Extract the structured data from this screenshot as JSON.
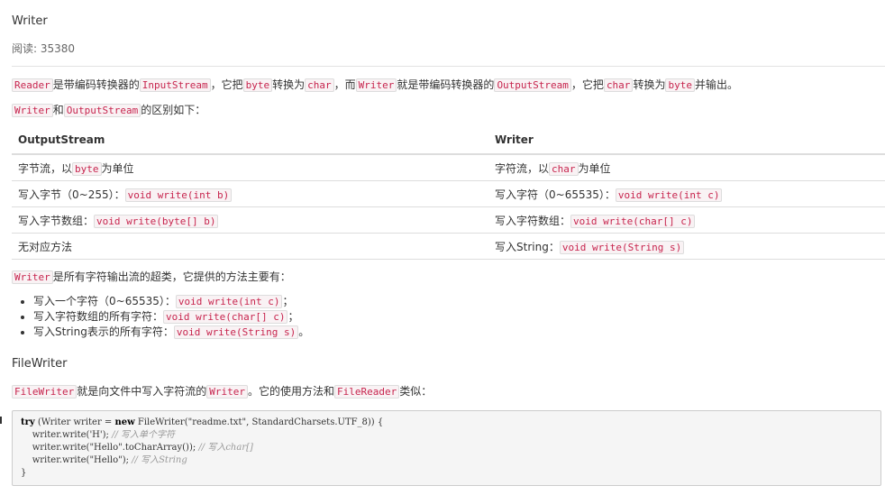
{
  "article": {
    "title": "Writer",
    "views_label": "阅读:",
    "views": "35380"
  },
  "intro": {
    "s1": "Reader",
    "s2": "是带编码转换器的",
    "s3": "InputStream",
    "s4": "，它把",
    "s5": "byte",
    "s6": "转换为",
    "s7": "char",
    "s8": "，而",
    "s9": "Writer",
    "s10": "就是带编码转换器的",
    "s11": "OutputStream",
    "s12": "，它把",
    "s13": "char",
    "s14": "转换为",
    "s15": "byte",
    "s16": "并输出。"
  },
  "diff": {
    "a": "Writer",
    "b": "和",
    "c": "OutputStream",
    "d": "的区别如下："
  },
  "table": {
    "h1": "OutputStream",
    "h2": "Writer",
    "r1": {
      "l_pre": "字节流，以",
      "l_code": "byte",
      "l_post": "为单位",
      "r_pre": "字符流，以",
      "r_code": "char",
      "r_post": "为单位"
    },
    "r2": {
      "l_pre": "写入字节（0~255）：",
      "l_code": "void write(int b)",
      "r_pre": "写入字符（0~65535）：",
      "r_code": "void write(int c)"
    },
    "r3": {
      "l_pre": "写入字节数组：",
      "l_code": "void write(byte[] b)",
      "r_pre": "写入字符数组：",
      "r_code": "void write(char[] c)"
    },
    "r4": {
      "l_text": "无对应方法",
      "r_pre": "写入String：",
      "r_code": "void write(String s)"
    }
  },
  "super": {
    "code": "Writer",
    "text": "是所有字符输出流的超类，它提供的方法主要有："
  },
  "methods": [
    {
      "pre": "写入一个字符（0~65535）：",
      "code": "void write(int c)",
      "post": "；"
    },
    {
      "pre": "写入字符数组的所有字符：",
      "code": "void write(char[] c)",
      "post": "；"
    },
    {
      "pre": "写入String表示的所有字符：",
      "code": "void write(String s)",
      "post": "。"
    }
  ],
  "filewriter": {
    "heading": "FileWriter",
    "c1": "FileWriter",
    "t1": "就是向文件中写入字符流的",
    "c2": "Writer",
    "t2": "。它的使用方法和",
    "c3": "FileReader",
    "t3": "类似："
  },
  "code_block": {
    "l1_kw": "try",
    "l1_a": " (Writer writer = ",
    "l1_kw2": "new",
    "l1_b": " FileWriter(",
    "l1_str": "\"readme.txt\"",
    "l1_c": ", StandardCharsets.UTF_8)) {",
    "l2_a": "    writer.write(",
    "l2_str": "'H'",
    "l2_b": "); ",
    "l2_cm": "// 写入单个字符",
    "l3_a": "    writer.write(",
    "l3_str": "\"Hello\"",
    "l3_b": ".toCharArray()); ",
    "l3_cm": "// 写入char[]",
    "l4_a": "    writer.write(",
    "l4_str": "\"Hello\"",
    "l4_b": "); ",
    "l4_cm": "// 写入String",
    "l5": "}"
  }
}
